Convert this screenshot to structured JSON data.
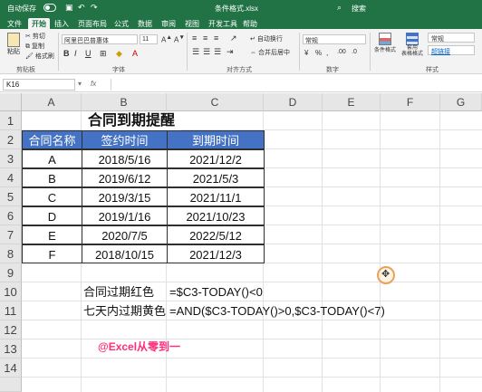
{
  "titlebar": {
    "autosave_label": "自动保存",
    "doc_title": "条件格式.xlsx",
    "search_label": "搜索",
    "accent_color": "#217346"
  },
  "menu": {
    "tabs": [
      "文件",
      "开始",
      "插入",
      "页面布局",
      "公式",
      "数据",
      "审阅",
      "视图",
      "开发工具",
      "帮助"
    ],
    "active": "开始"
  },
  "ribbon": {
    "paste_label": "粘贴",
    "cut_label": "剪切",
    "copy_label": "复制",
    "format_painter_label": "格式刷",
    "clipboard_group": "剪贴板",
    "font_name": "阿里巴巴普惠体",
    "font_size": "11",
    "font_group": "字体",
    "wrap_text_label": "自动换行",
    "merge_center_label": "合并后居中",
    "alignment_group": "对齐方式",
    "number_format": "常规",
    "number_group": "数字",
    "conditional_format_label": "条件格式",
    "format_as_table_label": "套用\n表格格式",
    "style_normal": "常规",
    "style_hyperlink": "超链接",
    "styles_group": "样式"
  },
  "formula_bar": {
    "name_box": "K16",
    "fx_label": "fx",
    "formula": ""
  },
  "grid": {
    "columns": [
      "A",
      "B",
      "C",
      "D",
      "E",
      "F",
      "G"
    ],
    "rows": [
      "1",
      "2",
      "3",
      "4",
      "5",
      "6",
      "7",
      "8",
      "9",
      "10",
      "11",
      "12",
      "13",
      "14"
    ]
  },
  "sheet": {
    "title": "合同到期提醒",
    "headers": [
      "合同名称",
      "签约时间",
      "到期时间"
    ],
    "header_color": "#4472c4",
    "rows": [
      [
        "A",
        "2018/5/16",
        "2021/12/2"
      ],
      [
        "B",
        "2019/6/12",
        "2021/5/3"
      ],
      [
        "C",
        "2019/3/15",
        "2021/11/1"
      ],
      [
        "D",
        "2019/1/16",
        "2021/10/23"
      ],
      [
        "E",
        "2020/7/5",
        "2022/5/12"
      ],
      [
        "F",
        "2018/10/15",
        "2021/12/3"
      ]
    ],
    "note1_label": "合同过期红色",
    "note1_formula": "=$C3-TODAY()<0",
    "note2_label": "七天内过期黄色",
    "note2_formula": "=AND($C3-TODAY()>0,$C3-TODAY()<7)",
    "brand_text": "@Excel从零到一",
    "brand_color": "#ff2d7a"
  }
}
